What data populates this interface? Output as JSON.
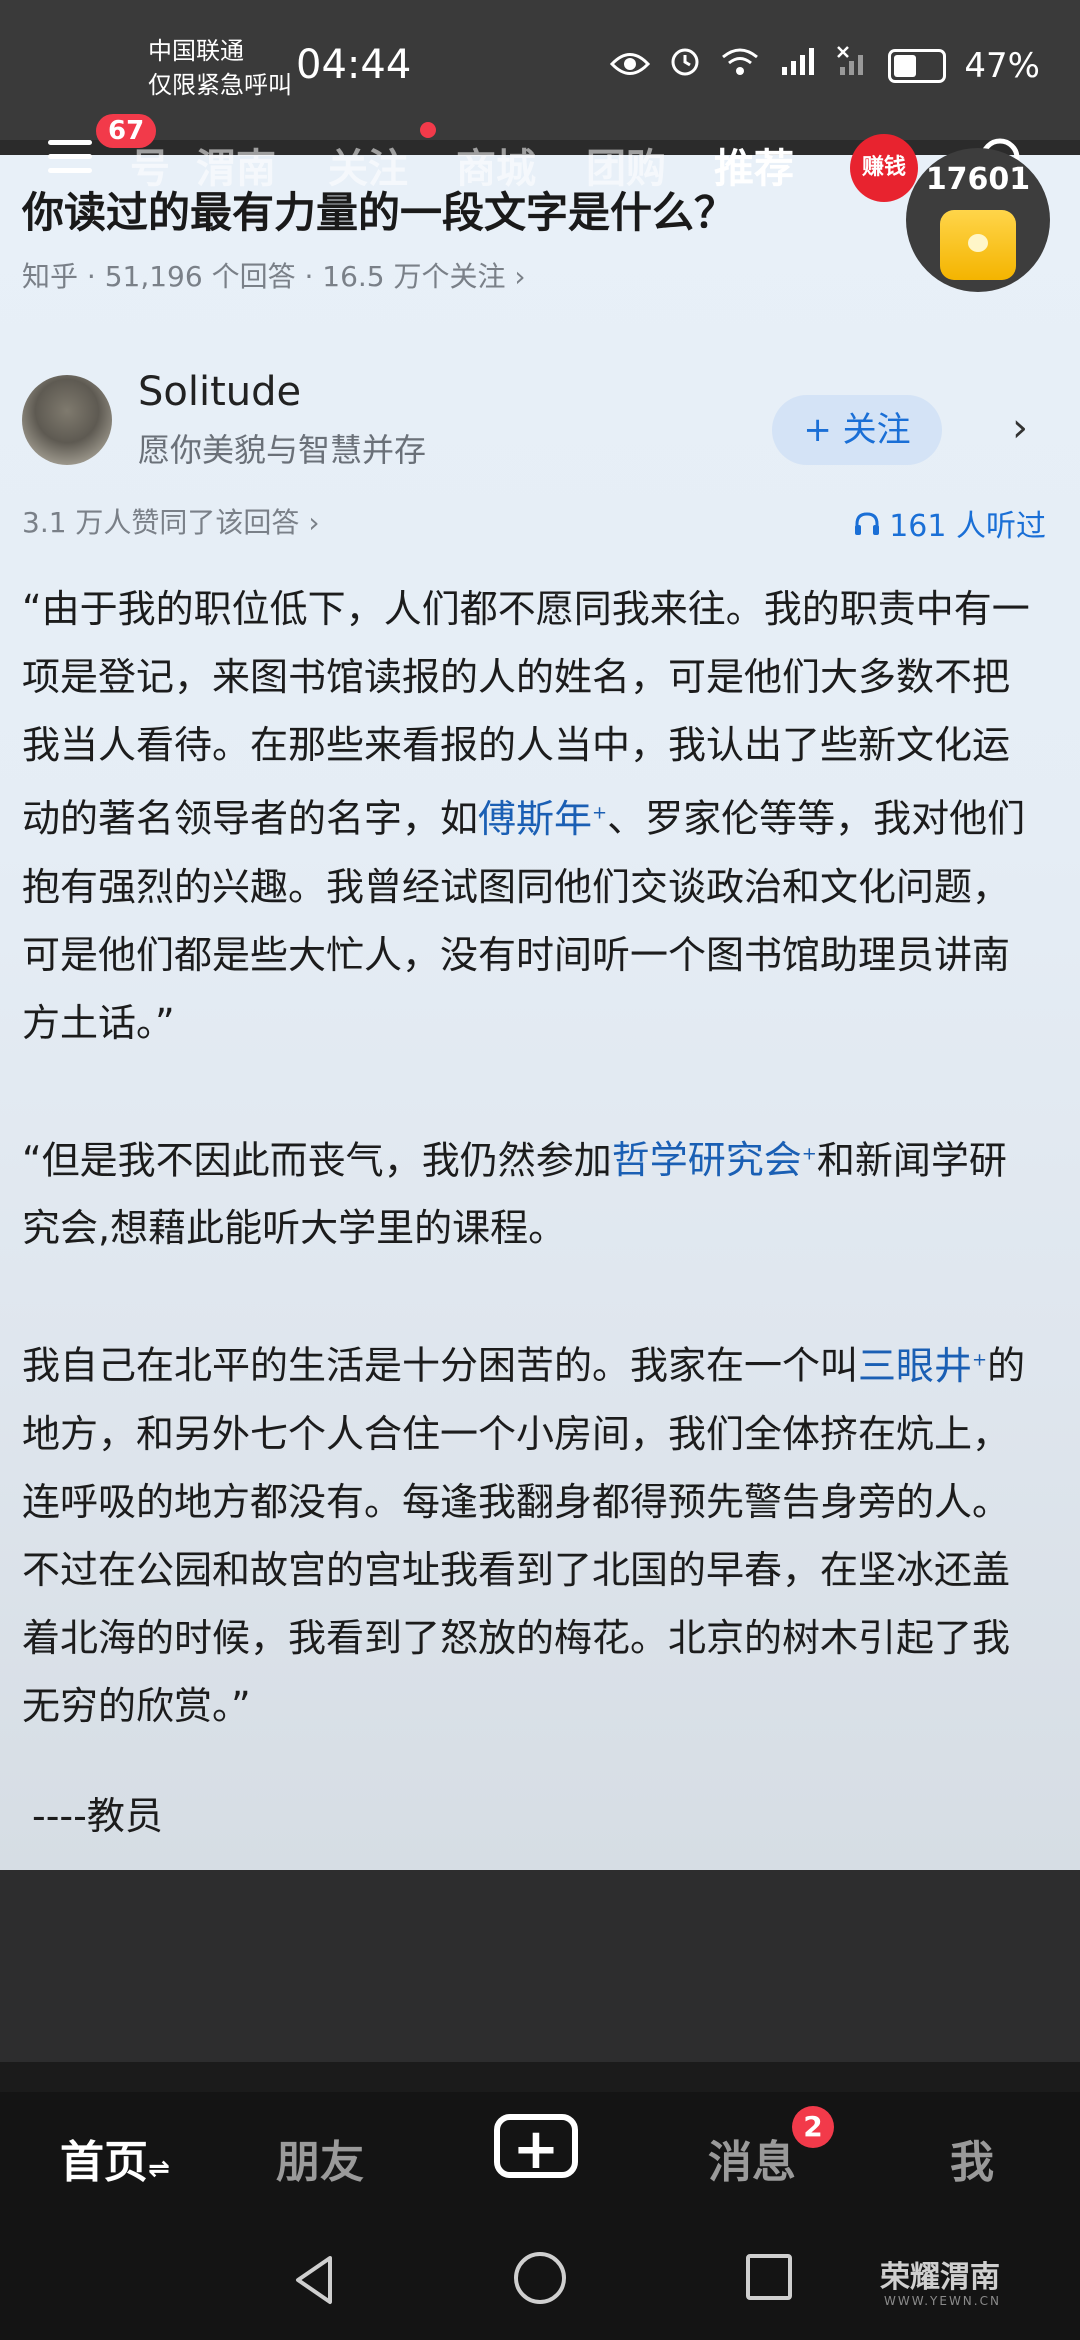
{
  "status_bar": {
    "carrier_line1": "中国联通",
    "carrier_line2": "仅限紧急呼叫",
    "time": "04:44",
    "battery": "47%",
    "battery_level": 0.47
  },
  "top_nav": {
    "menu_badge": "67",
    "tabs": [
      "号",
      "渭南",
      "关注",
      "商城",
      "团购",
      "推荐"
    ],
    "earn_label": "赚钱"
  },
  "question": {
    "title": "你读过的最有力量的一段文字是什么？",
    "meta": "知乎 · 51,196 个回答 · 16.5 万个关注 ›"
  },
  "coin_widget": {
    "count": "17601"
  },
  "author": {
    "name": "Solitude",
    "bio": "愿你美貌与智慧并存",
    "follow_label": "+ 关注"
  },
  "stats": {
    "likes": "3.1 万人赞同了该回答 ›",
    "listens": "161 人听过"
  },
  "body": {
    "p1_a": "“由于我的职位低下，人们都不愿同我来往。我的职责中有一项是登记，来图书馆读报的人的姓名，可是他们大多数不把我当人看待。在那些来看报的人当中，我认出了些新文化运动的著名领导者的名字，如",
    "p1_link": "傅斯年",
    "p1_b": "、罗家伦等等，我对他们抱有强烈的兴趣。我曾经试图同他们交谈政治和文化问题，可是他们都是些大忙人，没有时间听一个图书馆助理员讲南方土话。”",
    "p2_a": "“但是我不因此而丧气，我仍然参加",
    "p2_link": "哲学研究会",
    "p2_b": "和新闻学研究会,想藉此能听大学里的课程。",
    "p3_a": "我自己在北平的生活是十分困苦的。我家在一个叫",
    "p3_link": "三眼井",
    "p3_b": "的地方，和另外七个人合住一个小房间，我们全体挤在炕上，连呼吸的地方都没有。每逢我翻身都得预先警告身旁的人。不过在公园和故宫的宫址我看到了北国的早春，在坚冰还盖着北海的时候，我看到了怒放的梅花。北京的树木引起了我无穷的欣赏。”",
    "signoff": "----教员",
    "link_mark": "+"
  },
  "bottom_tabs": {
    "home": "首页",
    "home_suffix": "⇌",
    "friends": "朋友",
    "add": "+",
    "messages": "消息",
    "messages_badge": "2",
    "me": "我"
  },
  "watermark": {
    "text": "荣耀渭南",
    "sub": "WWW.YEWN.CN"
  }
}
